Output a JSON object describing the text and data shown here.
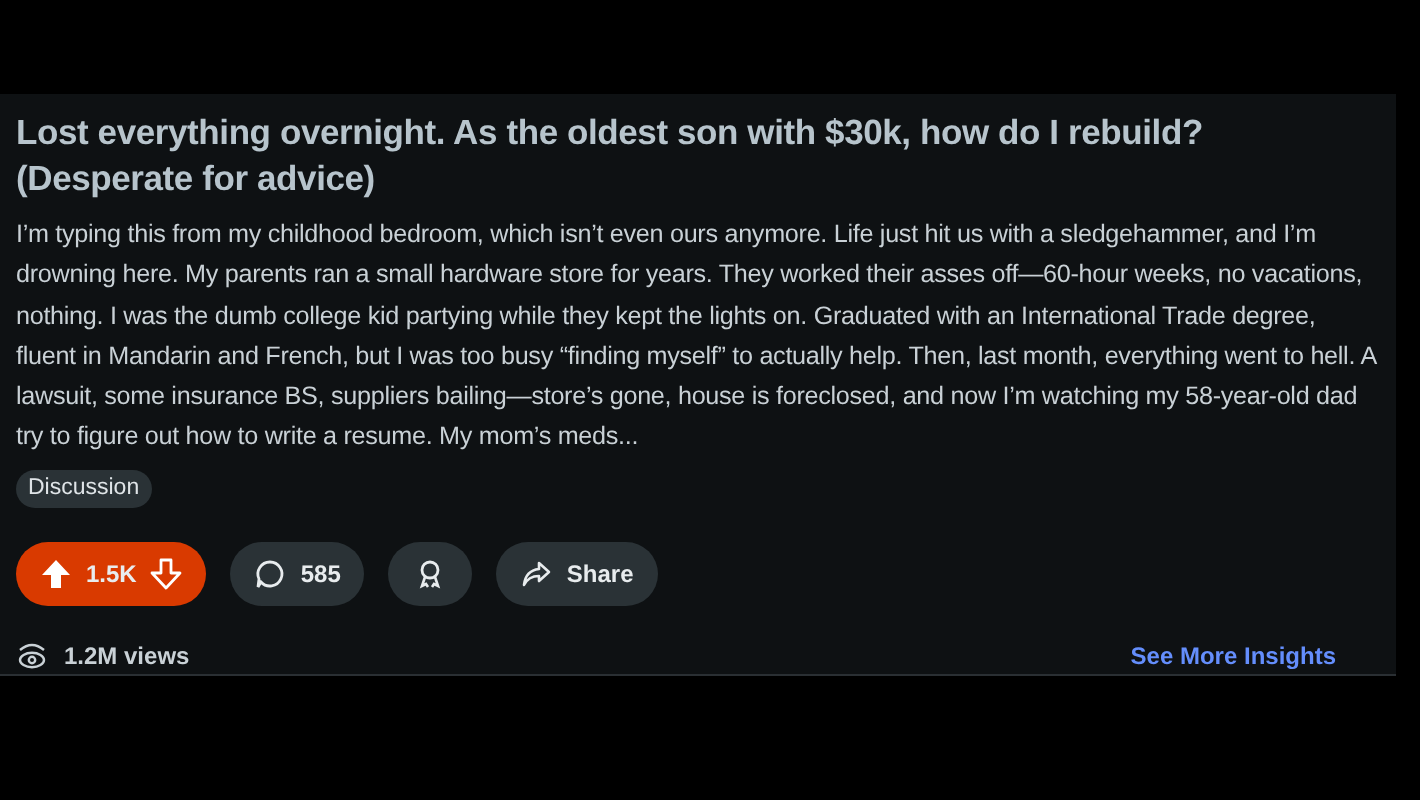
{
  "post": {
    "title": "Lost everything overnight. As the oldest son with $30k, how do I rebuild? (Desperate for advice)",
    "body": "I’m typing this from my childhood bedroom, which isn’t even ours anymore. Life just hit us with a sledgehammer, and I’m drowning here. My parents ran a small hardware store for years. They worked their asses off—60-hour weeks, no vacations, nothing. I was the dumb college kid partying while they kept the lights on. Graduated with an International Trade degree, fluent in Mandarin and French, but I was too busy “finding myself” to actually help. Then, last month, everything went to hell. A lawsuit, some insurance BS, suppliers bailing—store’s gone, house is foreclosed, and now I’m watching my 58-year-old dad try to figure out how to write a resume. My mom’s meds...",
    "flair": "Discussion"
  },
  "actions": {
    "vote": {
      "count": "1.5K",
      "upvoted": true
    },
    "comments": "585",
    "share": "Share"
  },
  "stats": {
    "views": "1.2M views",
    "insights_link": "See More Insights"
  }
}
